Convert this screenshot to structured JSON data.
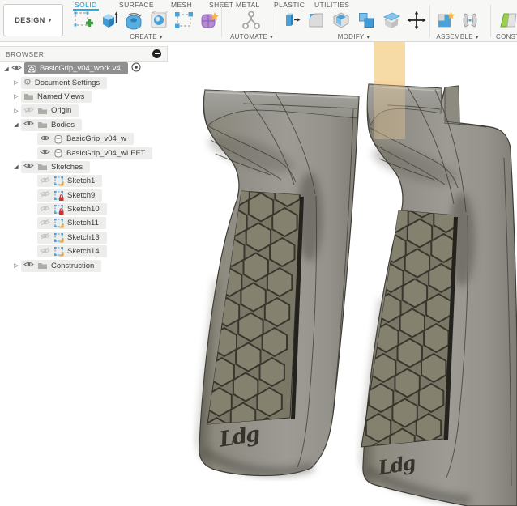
{
  "ui": {
    "caret": "▾"
  },
  "toolbar": {
    "design_label": "DESIGN",
    "tabs": [
      {
        "label": "SOLID",
        "active": true
      },
      {
        "label": "SURFACE",
        "active": false
      },
      {
        "label": "MESH",
        "active": false
      },
      {
        "label": "SHEET METAL",
        "active": false
      },
      {
        "label": "PLASTIC",
        "active": false
      },
      {
        "label": "UTILITIES",
        "active": false
      }
    ],
    "groups": [
      {
        "label": "CREATE"
      },
      {
        "label": "AUTOMATE"
      },
      {
        "label": "MODIFY"
      },
      {
        "label": "ASSEMBLE"
      },
      {
        "label": "CONST"
      }
    ]
  },
  "browser": {
    "title": "BROWSER",
    "items": [
      {
        "label": "BasicGrip_v04_work v4"
      },
      {
        "label": "Document Settings"
      },
      {
        "label": "Named Views"
      },
      {
        "label": "Origin"
      },
      {
        "label": "Bodies"
      },
      {
        "label": "BasicGrip_v04_w"
      },
      {
        "label": "BasicGrip_v04_wLEFT"
      },
      {
        "label": "Sketches"
      },
      {
        "label": "Sketch1"
      },
      {
        "label": "Sketch9"
      },
      {
        "label": "Sketch10"
      },
      {
        "label": "Sketch11"
      },
      {
        "label": "Sketch13"
      },
      {
        "label": "Sketch14"
      },
      {
        "label": "Construction"
      }
    ]
  },
  "viewport": {
    "logo_left": "Ldg",
    "logo_right": "Ldg",
    "colors": {
      "accent_blue": "#0a9bd7",
      "selection_band_tan": "#f7dba6",
      "grip_body": "#8b887b",
      "grip_panel": "#7b7767",
      "selected_item_gray": "#8f8f8f"
    }
  }
}
